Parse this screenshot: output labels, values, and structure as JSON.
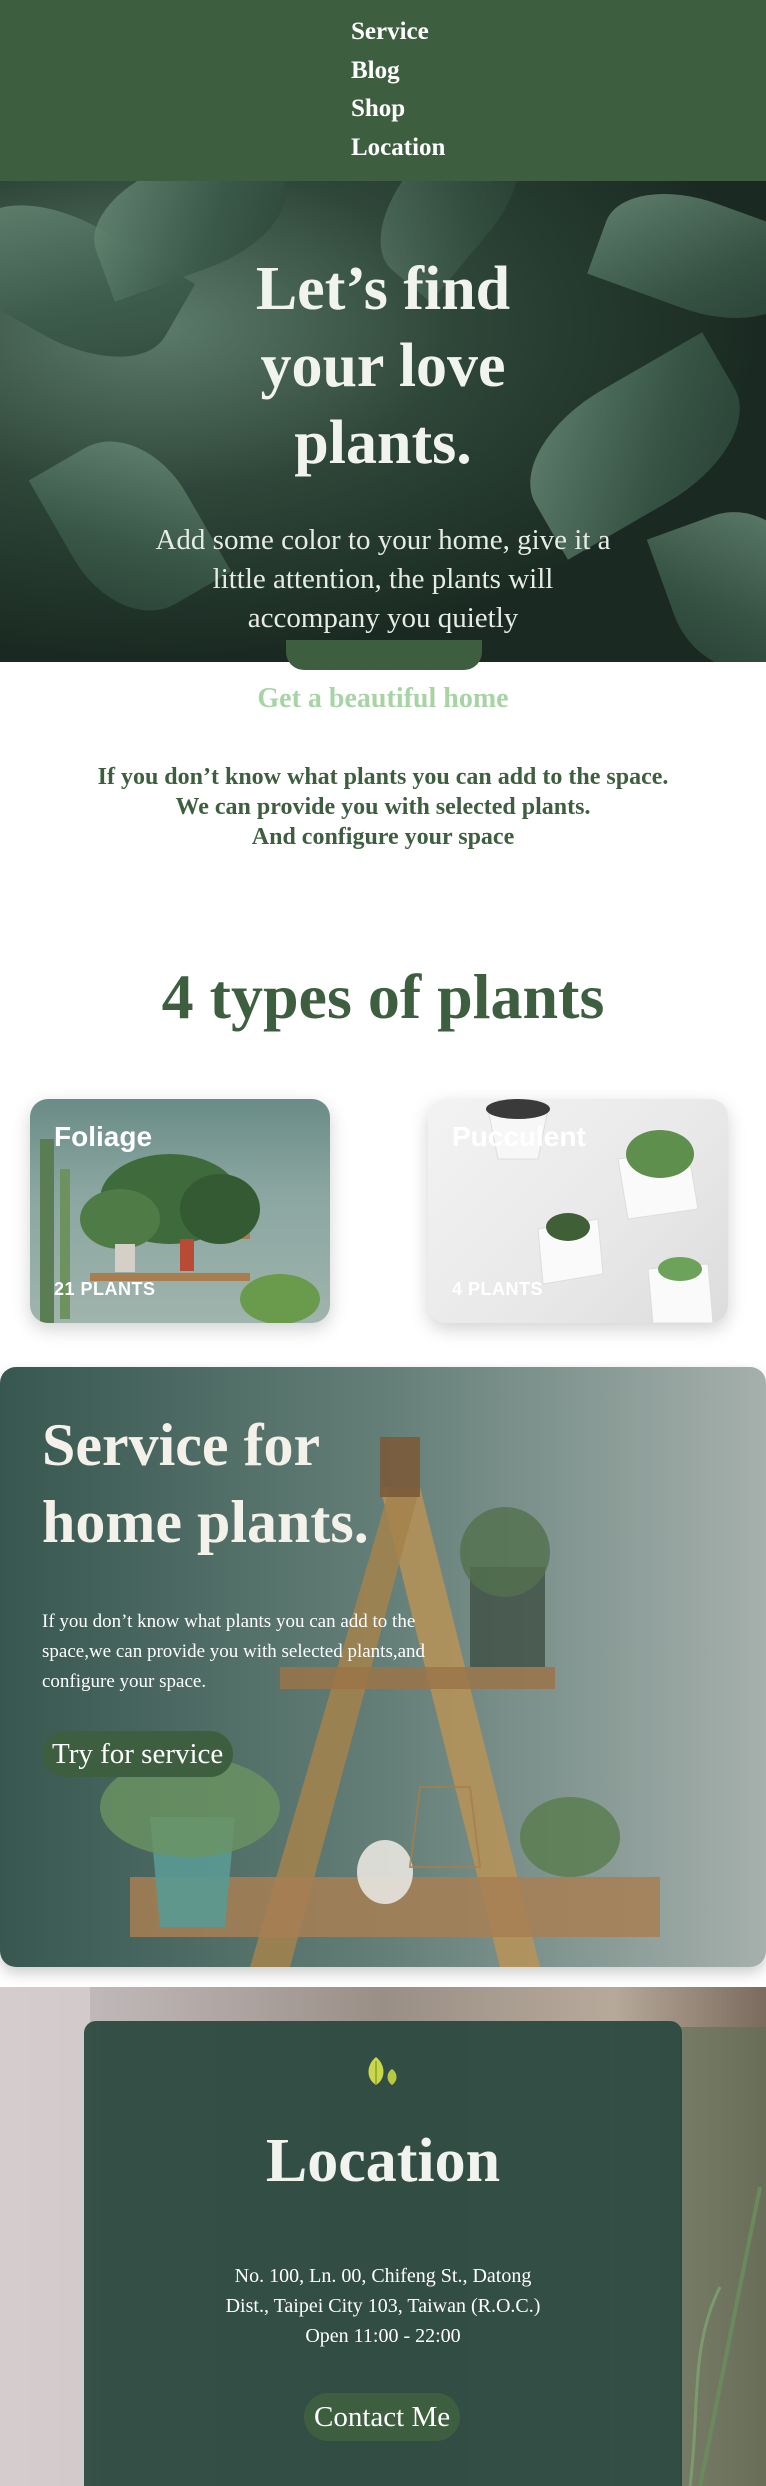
{
  "nav": {
    "items": [
      "Service",
      "Blog",
      "Shop",
      "Location"
    ]
  },
  "hero": {
    "title_lines": [
      "Let’s find",
      "your love",
      "plants."
    ],
    "subtitle": "Add some color to your home, give it a little attention, the plants will accompany you quietly"
  },
  "tagline": "Get a beautiful home",
  "intro": {
    "lines": [
      "If you don’t know what plants you can add to the space.",
      "We can provide you with selected plants.",
      "And configure your space"
    ]
  },
  "types": {
    "title": "4 types of plants",
    "cards": [
      {
        "name": "Foliage",
        "count": "21 PLANTS"
      },
      {
        "name": "Pucculent",
        "count": "4 PLANTS"
      }
    ]
  },
  "service": {
    "title_lines": [
      "Service for",
      "home plants."
    ],
    "text": "If you don’t know what plants you can add to the space,we can provide you with selected plants,and configure your space.",
    "button": "Try for service"
  },
  "location": {
    "title": "Location",
    "address_lines": [
      "No. 100, Ln. 00, Chifeng St., Datong",
      "Dist., Taipei City 103, Taiwan (R.O.C.)",
      "Open 11:00 - 22:00"
    ],
    "button": "Contact Me"
  },
  "colors": {
    "primary": "#3e5f3f",
    "accent_light": "#a7d4a4",
    "card_dark": "#2c4a40"
  }
}
